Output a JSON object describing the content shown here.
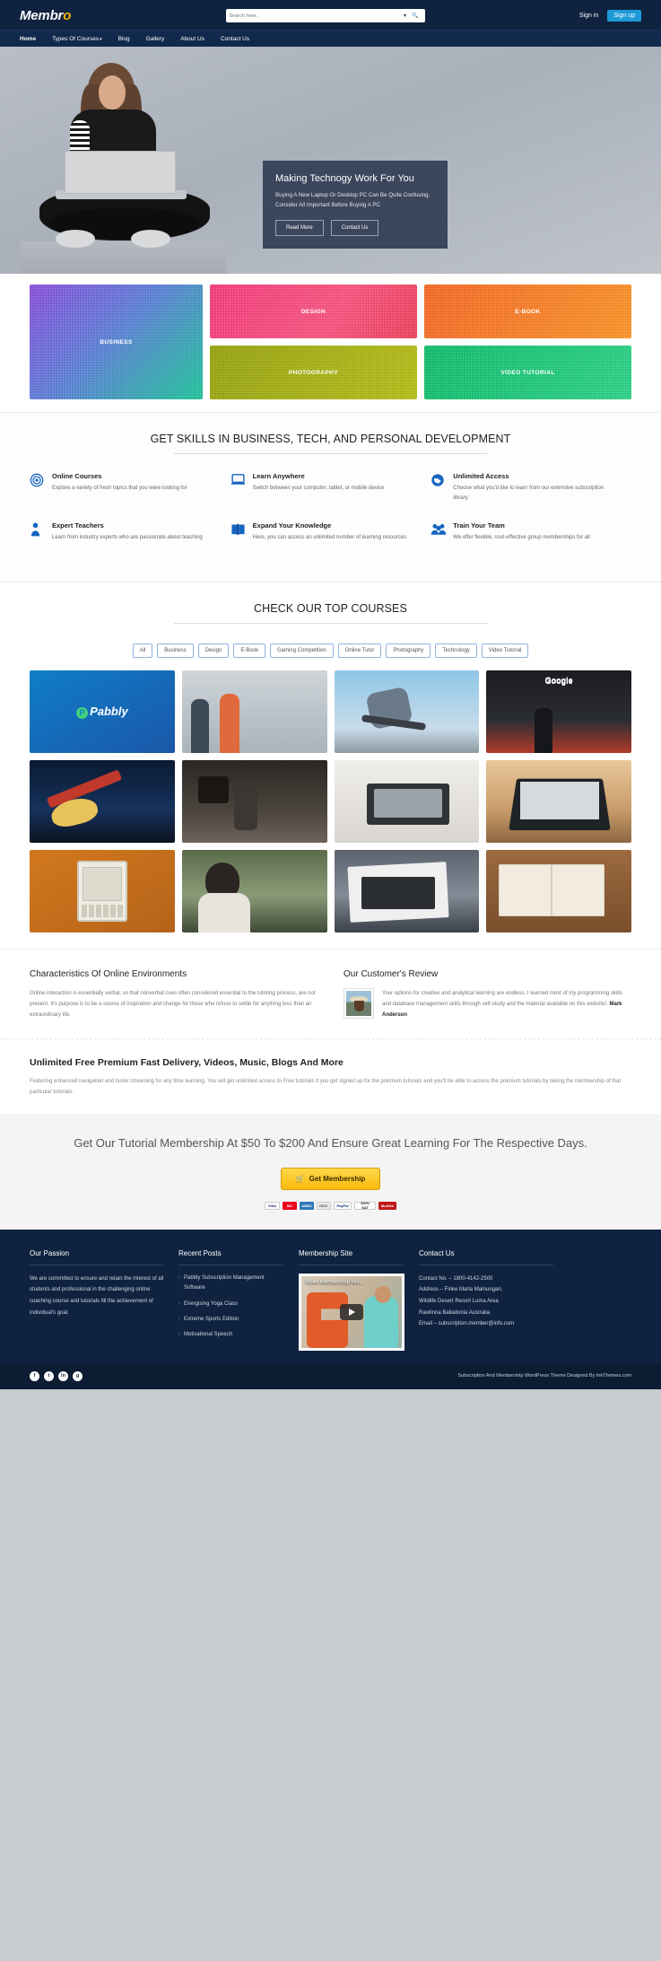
{
  "header": {
    "logo_main": "Membr",
    "logo_accent": "o",
    "search_placeholder": "Search here..",
    "caret_icon": "chevron-down-icon",
    "search_icon": "search-icon",
    "sign_in": "Sign in",
    "sign_up": "Sign up",
    "accent_color": "#f5b50a",
    "signup_color": "#1e9bd7",
    "bar_color": "#0f2340"
  },
  "nav": {
    "items": [
      {
        "label": "Home",
        "has_caret": false
      },
      {
        "label": "Types Of Courses",
        "has_caret": true
      },
      {
        "label": "Blog",
        "has_caret": false
      },
      {
        "label": "Gallery",
        "has_caret": false
      },
      {
        "label": "About Us",
        "has_caret": false
      },
      {
        "label": "Contact Us",
        "has_caret": false
      }
    ]
  },
  "hero": {
    "title": "Making Technogy Work For You",
    "subtitle": "Buying A New Laptop Or Desktop PC Can Be Quite Confusing. Consider All Important Before Buying A PC",
    "btn_primary": "Read More",
    "btn_secondary": "Contact Us"
  },
  "categories": [
    {
      "label": "BUSINESS",
      "size": "big"
    },
    {
      "label": "DESIGN",
      "size": "small"
    },
    {
      "label": "E-BOOK",
      "size": "small"
    },
    {
      "label": "PHOTOGRAPHY",
      "size": "small"
    },
    {
      "label": "VIDEO TUTORIAL",
      "size": "small"
    }
  ],
  "skills": {
    "title": "GET SKILLS IN BUSINESS, TECH, AND PERSONAL DEVELOPMENT",
    "features": [
      {
        "icon": "target-icon",
        "title": "Online Courses",
        "text": "Explore a variety of fresh topics that you were looking for"
      },
      {
        "icon": "laptop-icon",
        "title": "Learn Anywhere",
        "text": "Switch between your computer, tablet, or mobile device"
      },
      {
        "icon": "globe-icon",
        "title": "Unlimited Access",
        "text": "Choose what you'd like to learn from our extensive subscription library."
      },
      {
        "icon": "person-icon",
        "title": "Expert Teachers",
        "text": "Learn from industry experts who are passionate about teaching"
      },
      {
        "icon": "book-icon",
        "title": "Expand Your Knowledge",
        "text": "Here, you can access an unlimited number of learning resources"
      },
      {
        "icon": "group-icon",
        "title": "Train Your Team",
        "text": "We offer flexible, cost-effective group memberships for all"
      }
    ]
  },
  "courses": {
    "title": "CHECK OUR TOP COURSES",
    "filters": [
      "All",
      "Business",
      "Design",
      "E-Book",
      "Gaming Competition",
      "Online Tutor",
      "Photography",
      "Technology",
      "Video Tutorial"
    ],
    "cards": [
      {
        "name": "pabbly-card",
        "class": "c1"
      },
      {
        "name": "fitness-class-card",
        "class": "c2"
      },
      {
        "name": "skateboard-card",
        "class": "c3"
      },
      {
        "name": "google-conference-card",
        "class": "c4"
      },
      {
        "name": "guitar-card",
        "class": "c5"
      },
      {
        "name": "camera-studio-card",
        "class": "c6"
      },
      {
        "name": "tablet-desk-card",
        "class": "c7"
      },
      {
        "name": "laptop-card",
        "class": "c8"
      },
      {
        "name": "ereader-card",
        "class": "c9"
      },
      {
        "name": "woman-tablet-card",
        "class": "c10"
      },
      {
        "name": "newspaper-tablet-card",
        "class": "c11"
      },
      {
        "name": "open-book-card",
        "class": "c12"
      }
    ]
  },
  "characteristics": {
    "title": "Characteristics Of Online Environments",
    "text": "Online interaction is essentially verbal, so that nonverbal cues often considered essential to the tutoring process, are not present. It's purpose is to be a source of inspiration and change for those who refuse to settle for anything less than an extraordinary life."
  },
  "review": {
    "title": "Our Customer's Review",
    "text": "Your options for creative and analytical learning are endless. I learned most of my programming skills and database management skills through self-study and the material available on this website!.",
    "author": "Mark Anderson"
  },
  "unlimited": {
    "title": "Unlimited Free Premium Fast Delivery, Videos, Music, Blogs And More",
    "text": "Featuring enhanced navigation and faster streaming for any time learning. You will get unlimited access to Free tutorials if you get signed up for the premium tutorials and you'll be able to access the premium tutorials by taking the membership of that particular tutorials."
  },
  "cta": {
    "headline": "Get Our Tutorial Membership At $50 To $200 And Ensure Great Learning For The Respective Days.",
    "button": "Get Membership",
    "cart_icon": "cart-icon",
    "badges": [
      "VISA",
      "MC",
      "AMEX",
      "DISC",
      "PayPal",
      "100% SAT",
      "McAfee"
    ]
  },
  "footer": {
    "passion": {
      "title": "Our Passion",
      "text": "We are committed to ensure and retain the interest of all students and professional in the challenging online coaching course and tutorials till the achievement of individual's goal."
    },
    "recent": {
      "title": "Recent Posts",
      "items": [
        "Pabbly Subscription Management Software",
        "Energising Yoga Class",
        "Extreme Sports Edition",
        "Motivational Speech"
      ]
    },
    "membership": {
      "title": "Membership Site",
      "video_title": "Video Membership Wo...",
      "play_icon": "play-icon"
    },
    "contact": {
      "title": "Contact Us",
      "lines": [
        "Contact No. – 1800-4142-2500",
        "Address – Finke Marla Mamungari,",
        "Wildlife Desert Resort Luma Area",
        "Rawlinna Balladonia Australia",
        "Email – subscription.member@info.com"
      ]
    },
    "socials": [
      "f",
      "t",
      "in",
      "g"
    ],
    "copyright": "Subscription And Membership WordPress Theme Designed By InkThemes.com"
  }
}
